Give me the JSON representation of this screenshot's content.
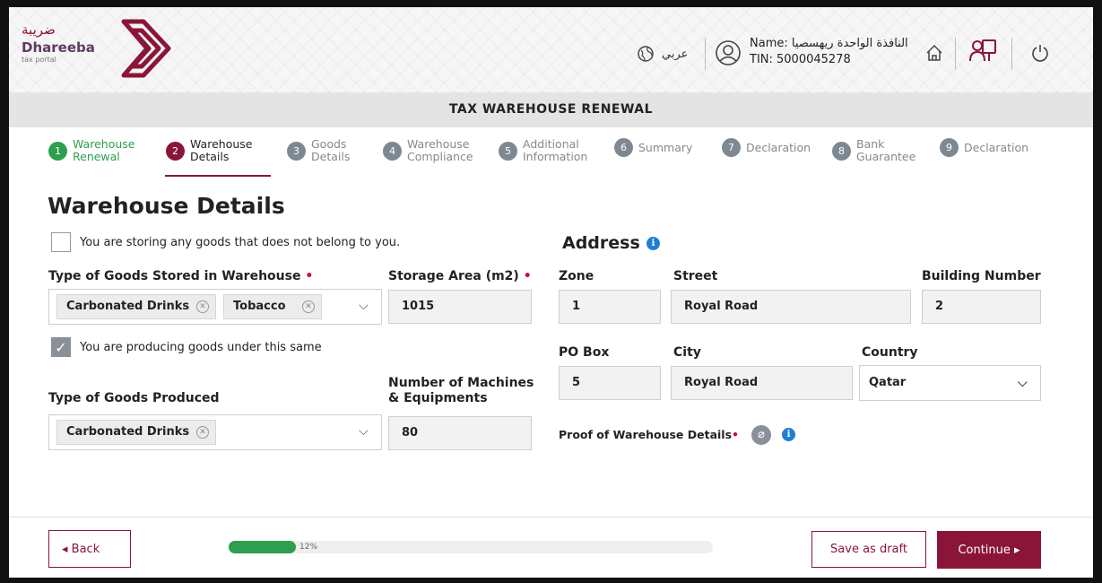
{
  "header": {
    "logo_arabic": "ضريبة",
    "logo_name": "Dhareeba",
    "logo_subtitle": "tax portal",
    "language_label": "عربي",
    "user_name": "Name: النافذة الواحدة ريهسصيا",
    "user_tin": "TIN: 5000045278",
    "icons": [
      "globe-icon",
      "user-icon",
      "home-icon",
      "handshake-icon",
      "power-icon"
    ]
  },
  "title_bar": "TAX WAREHOUSE RENEWAL",
  "steps": [
    {
      "num": "1",
      "label1": "Warehouse",
      "label2": "Renewal",
      "state": "done"
    },
    {
      "num": "2",
      "label1": "Warehouse",
      "label2": "Details",
      "state": "active"
    },
    {
      "num": "3",
      "label1": "Goods",
      "label2": "Details",
      "state": "todo"
    },
    {
      "num": "4",
      "label1": "Warehouse",
      "label2": "Compliance",
      "state": "todo"
    },
    {
      "num": "5",
      "label1": "Additional",
      "label2": "Information",
      "state": "todo"
    },
    {
      "num": "6",
      "label1": "Summary",
      "label2": "",
      "state": "todo"
    },
    {
      "num": "7",
      "label1": "Declaration",
      "label2": "",
      "state": "todo"
    },
    {
      "num": "8",
      "label1": "Bank",
      "label2": "Guarantee",
      "state": "todo"
    },
    {
      "num": "9",
      "label1": "Declaration",
      "label2": "",
      "state": "todo"
    }
  ],
  "form": {
    "page_title": "Warehouse Details",
    "not_own_goods_label": "You are storing any goods that does not belong to you.",
    "not_own_goods_checked": false,
    "stored_goods_label": "Type of Goods Stored in Warehouse",
    "stored_goods_tags": [
      "Carbonated Drinks",
      "Tobacco"
    ],
    "storage_area_label": "Storage Area (m2)",
    "storage_area_value": "1015",
    "producing_label": "You are producing goods under this same",
    "producing_checked": true,
    "produced_goods_label": "Type of Goods Produced",
    "produced_goods_tags": [
      "Carbonated Drinks"
    ],
    "machines_label_line1": "Number of Machines",
    "machines_label_line2": "& Equipments",
    "machines_value": "80",
    "required_mark": "•"
  },
  "address": {
    "title": "Address",
    "zone_label": "Zone",
    "zone_value": "1",
    "street_label": "Street",
    "street_value": "Royal Road",
    "building_label": "Building Number",
    "building_value": "2",
    "po_box_label": "PO Box",
    "po_box_value": "5",
    "city_label": "City",
    "city_value": "Royal Road",
    "country_label": "Country",
    "country_value": "Qatar",
    "proof_label": "Proof of Warehouse Details"
  },
  "footer": {
    "back_label": "◂  Back",
    "progress_percent": 12,
    "progress_text": "12%",
    "save_draft_label": "Save as draft",
    "continue_label": "Continue  ▸"
  },
  "colors": {
    "brand": "#8a1538",
    "done": "#2e9e4f",
    "info": "#1f7fd4"
  }
}
